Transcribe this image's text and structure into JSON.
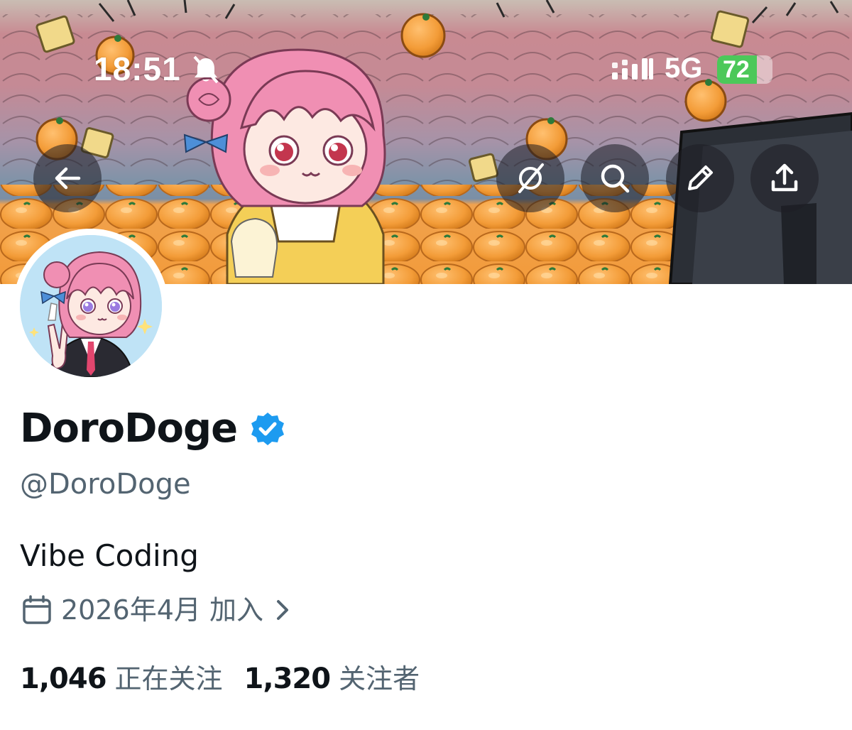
{
  "status_bar": {
    "time": "18:51",
    "network": "5G",
    "battery": "72",
    "battery_level": 0.72,
    "icons": [
      "bell-muted-icon",
      "signal-icon",
      "battery-charging-icon"
    ]
  },
  "banner": {
    "buttons": [
      {
        "name": "back-button",
        "icon": "arrow-left-icon"
      },
      {
        "name": "grok-button",
        "icon": "grok-icon"
      },
      {
        "name": "search-button",
        "icon": "search-icon"
      },
      {
        "name": "edit-button",
        "icon": "pencil-icon"
      },
      {
        "name": "share-button",
        "icon": "share-icon"
      }
    ]
  },
  "profile": {
    "display_name": "DoroDoge",
    "verified": true,
    "handle": "@DoroDoge",
    "bio": "Vibe Coding",
    "joined": "2026年4月 加入",
    "following_count": "1,046",
    "following_label": "正在关注",
    "followers_count": "1,320",
    "followers_label": "关注者"
  },
  "colors": {
    "primary_text": "#0f1419",
    "secondary_text": "#536471",
    "verified_blue": "#1d9bf0",
    "battery_green": "#4cc85a"
  }
}
